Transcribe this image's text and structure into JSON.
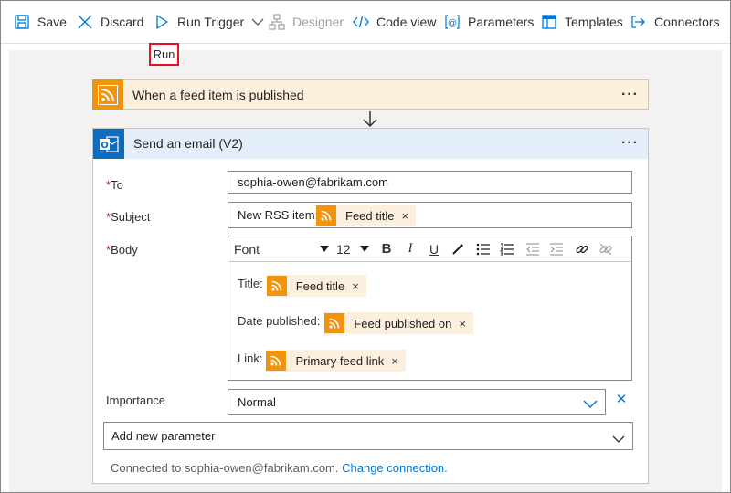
{
  "toolbar": {
    "save": "Save",
    "discard": "Discard",
    "run_trigger": "Run Trigger",
    "designer": "Designer",
    "code_view": "Code view",
    "parameters": "Parameters",
    "templates": "Templates",
    "connectors": "Connectors"
  },
  "tooltip": {
    "run": "Run"
  },
  "trigger": {
    "title": "When a feed item is published",
    "more": "···"
  },
  "action": {
    "title": "Send an email (V2)",
    "more": "···",
    "to": {
      "label": "To",
      "required": "*",
      "value": "sophia-owen@fabrikam.com"
    },
    "subject": {
      "label": "Subject",
      "required": "*",
      "prefix": "New RSS item:",
      "token": "Feed title",
      "token_remove": "×"
    },
    "body": {
      "label": "Body",
      "required": "*",
      "font": "Font",
      "size": "12",
      "lines": [
        {
          "label": "Title:",
          "token": "Feed title",
          "remove": "×"
        },
        {
          "label": "Date published:",
          "token": "Feed published on",
          "remove": "×"
        },
        {
          "label": "Link:",
          "token": "Primary feed link",
          "remove": "×"
        }
      ]
    },
    "importance": {
      "label": "Importance",
      "value": "Normal",
      "clear": "✕"
    },
    "add_parameter": "Add new parameter",
    "connection": {
      "text": "Connected to sophia-owen@fabrikam.com.",
      "change": "Change connection."
    }
  },
  "colors": {
    "rss": "#f2930d",
    "trigger_bg": "#fdefde",
    "action_head_bg": "#e4eefa",
    "accent": "#0078d4",
    "required": "#a4262c"
  },
  "icons": [
    "save-icon",
    "discard-icon",
    "play-icon",
    "chevron-down-icon",
    "designer-icon",
    "code-icon",
    "parameters-icon",
    "templates-icon",
    "connectors-icon",
    "rss-icon",
    "outlook-icon",
    "arrow-down-icon"
  ]
}
